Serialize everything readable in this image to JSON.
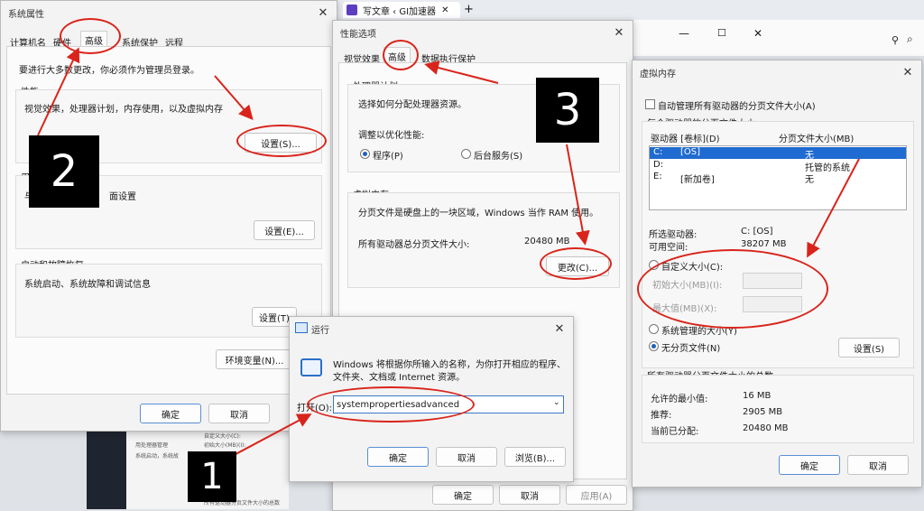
{
  "browser": {
    "tab_title": "写文章 ‹ GI加速器",
    "new_tab_plus": "+"
  },
  "sysprops": {
    "title": "系统属性",
    "tabs": [
      "计算机名",
      "硬件",
      "高级",
      "系统保护",
      "远程"
    ],
    "admin_note": "要进行大多数更改，你必须作为管理员登录。",
    "perf_label": "性能",
    "perf_desc": "视觉效果，处理器计划，内存使用，以及虚拟内存",
    "perf_btn": "设置(S)...",
    "profile_label": "用",
    "profile_desc_prefix": "与",
    "profile_desc_suffix": "面设置",
    "profile_btn": "设置(E)...",
    "startup_label": "启动和故障恢复",
    "startup_desc": "系统启动、系统故障和调试信息",
    "startup_btn": "设置(T)",
    "env_btn": "环境变量(N)...",
    "ok": "确定",
    "cancel": "取消"
  },
  "perfopts": {
    "title": "性能选项",
    "tabs": [
      "视觉效果",
      "高级",
      "数据执行保护"
    ],
    "proc_group": "处理器计划",
    "proc_desc": "选择如何分配处理器资源。",
    "adjust_label": "调整以优化性能:",
    "radio_program": "程序(P)",
    "radio_background": "后台服务(S)",
    "vm_group": "虚拟内存",
    "vm_desc": "分页文件是硬盘上的一块区域，Windows 当作 RAM 使用。",
    "vm_total_label": "所有驱动器总分页文件大小:",
    "vm_total_value": "20480 MB",
    "change_btn": "更改(C)...",
    "ok": "确定",
    "cancel": "取消",
    "apply": "应用(A)"
  },
  "vmem": {
    "title": "虚拟内存",
    "auto_manage": "自动管理所有驱动器的分页文件大小(A)",
    "per_drive_label": "每个驱动器的分页文件大小",
    "col_drive": "驱动器 [卷标](D)",
    "col_size": "分页文件大小(MB)",
    "rows": [
      {
        "drive": "C:",
        "label": "[OS]",
        "size": "无"
      },
      {
        "drive": "D:",
        "label": "",
        "size": "托管的系统"
      },
      {
        "drive": "E:",
        "label": "[新加卷]",
        "size": "无"
      }
    ],
    "selected_drive_label": "所选驱动器:",
    "selected_drive_value": "C:   [OS]",
    "free_space_label": "可用空间:",
    "free_space_value": "38207 MB",
    "radio_custom": "自定义大小(C):",
    "initial_size": "初始大小(MB)(I):",
    "max_size": "最大值(MB)(X):",
    "radio_system": "系统管理的大小(Y)",
    "radio_none": "无分页文件(N)",
    "set_btn": "设置(S)",
    "total_group": "所有驱动器分页文件大小的总数",
    "min_label": "允许的最小值:",
    "min_value": "16 MB",
    "rec_label": "推荐:",
    "rec_value": "2905 MB",
    "cur_label": "当前已分配:",
    "cur_value": "20480 MB",
    "ok": "确定",
    "cancel": "取消"
  },
  "run": {
    "title": "运行",
    "desc_line1": "Windows 将根据你所输入的名称，为你打开相应的程序、",
    "desc_line2": "文件夹、文档或 Internet 资源。",
    "open_label": "打开(O):",
    "input_value": "systempropertiesadvanced",
    "ok": "确定",
    "cancel": "取消",
    "browse": "浏览(B)..."
  },
  "bg_fragment": {
    "line1": "自定义大小(C):",
    "line2": "初始大小(MB)(I):",
    "line3": "用处理器管理",
    "line4": "系统启动，系统故",
    "line5": "所有驱动器分页文件大小的总数"
  },
  "annotations": {
    "step1": "1",
    "step2": "2",
    "step3": "3",
    "accent": "#d9241b"
  }
}
